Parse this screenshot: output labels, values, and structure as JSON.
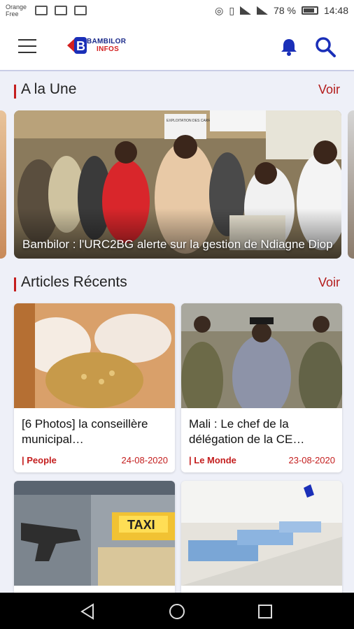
{
  "status_bar": {
    "carrier_line1": "Orange",
    "carrier_line2": "Free",
    "battery": "78 %",
    "time": "14:48"
  },
  "app_bar": {
    "menu_icon": "hamburger-menu-icon",
    "logo_line1": "BAMBILOR",
    "logo_line2": "INFOS",
    "notifications_icon": "bell-icon",
    "search_icon": "search-icon",
    "accent_color": "#1a2fb8"
  },
  "headline_section": {
    "title": "A la Une",
    "link": "Voir",
    "featured": {
      "caption": "Bambilor : l'URC2BG alerte sur la gestion de Ndiagne Diop",
      "sign_text": "EXPLOITATION DES CARRIERES DE SABLE"
    }
  },
  "recent_section": {
    "title": "Articles Récents",
    "link": "Voir",
    "articles": [
      {
        "title": "[6 Photos] la conseillère municipal…",
        "category": "| People",
        "date": "24-08-2020"
      },
      {
        "title": "Mali : Le chef de la délégation de la CE…",
        "category": "| Le Monde",
        "date": "23-08-2020"
      },
      {
        "title": "",
        "category": "",
        "date": "",
        "sign_text": "TAXI"
      },
      {
        "title": "",
        "category": "",
        "date": ""
      }
    ]
  },
  "nav_bar": {
    "back_icon": "back-triangle-icon",
    "home_icon": "home-circle-icon",
    "recents_icon": "recents-square-icon"
  }
}
